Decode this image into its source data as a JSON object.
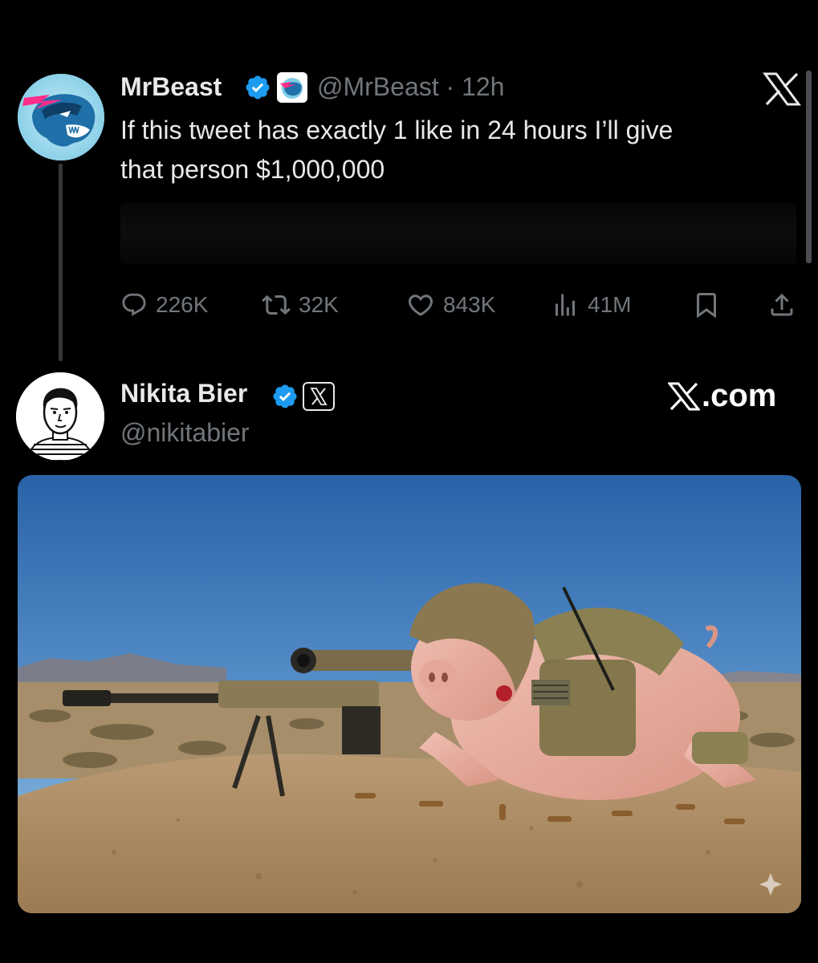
{
  "tweet1": {
    "display_name": "MrBeast",
    "handle": "@MrBeast",
    "separator": "·",
    "time": "12h",
    "text": "If this tweet has exactly 1 like in 24 hours I’ll give\nthat person $1,000,000",
    "actions": {
      "replies": "226K",
      "retweets": "32K",
      "likes": "843K",
      "views": "41M"
    }
  },
  "tweet2": {
    "display_name": "Nikita Bier",
    "handle": "@nikitabier",
    "brand": ".com"
  },
  "colors": {
    "background": "#000000",
    "text_primary": "#e7e9ea",
    "text_secondary": "#71767b",
    "verified_blue": "#1d9bf0",
    "thread_line": "#333639"
  },
  "icons": {
    "reply": "reply-icon",
    "retweet": "retweet-icon",
    "like": "heart-icon",
    "views": "views-icon",
    "bookmark": "bookmark-icon",
    "share": "share-icon"
  }
}
